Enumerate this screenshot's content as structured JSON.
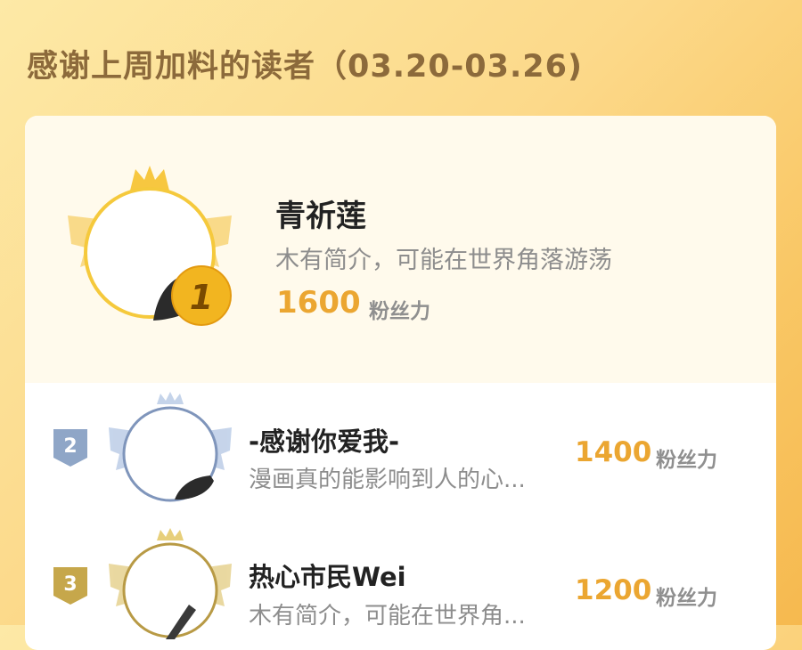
{
  "header": {
    "title": "感谢上周加料的读者（03.20-03.26)"
  },
  "leaderboard": [
    {
      "rank": "1",
      "name": "青祈莲",
      "bio": "木有简介，可能在世界角落游荡",
      "score": "1600",
      "unit": "粉丝力"
    },
    {
      "rank": "2",
      "name": "-感谢你爱我-",
      "bio": "漫画真的能影响到人的心...",
      "score": "1400",
      "unit": "粉丝力"
    },
    {
      "rank": "3",
      "name": "热心市民Wei",
      "bio": "木有简介，可能在世界角...",
      "score": "1200",
      "unit": "粉丝力"
    }
  ],
  "colors": {
    "gold": "#eba631",
    "silver": "#8fa6c7",
    "bronze": "#c6a74b",
    "title": "#8c6a3b"
  },
  "icons": [
    "crown-icon",
    "wings-icon",
    "rank-badge-icon"
  ]
}
